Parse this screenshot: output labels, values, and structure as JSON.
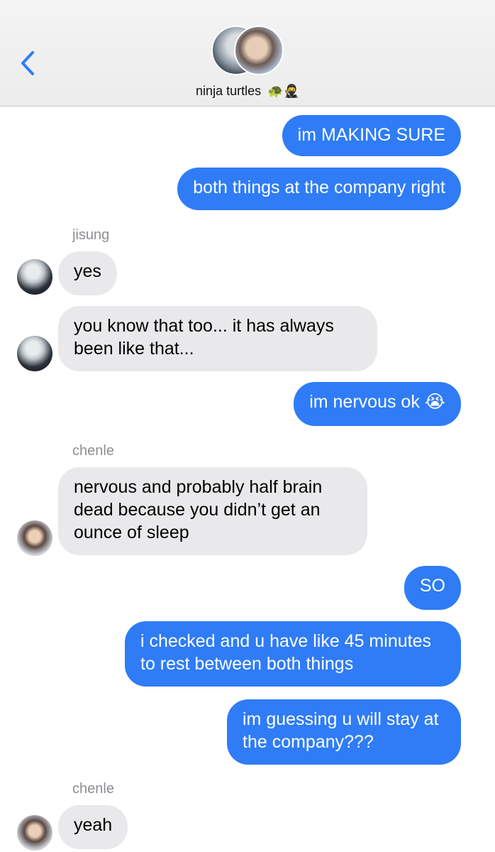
{
  "header": {
    "title": "ninja turtles",
    "title_emoji": "🐢🥷"
  },
  "messages": [
    {
      "type": "out",
      "text": "im MAKING SURE"
    },
    {
      "type": "out",
      "text": "both things at the company right"
    },
    {
      "sender": "jisung"
    },
    {
      "type": "in",
      "text": "yes"
    },
    {
      "type": "in",
      "lines": [
        "you know that too... it has always",
        "been like that..."
      ]
    },
    {
      "type": "out",
      "text": "im nervous ok",
      "emoji": "😭"
    },
    {
      "sender": "chenle"
    },
    {
      "type": "in",
      "lines": [
        "nervous and probably half brain",
        "dead because you didn’t get an",
        "ounce of sleep"
      ]
    },
    {
      "type": "out",
      "text": "SO"
    },
    {
      "type": "out",
      "lines": [
        "i checked and u have like 45 minutes",
        "to rest between both things"
      ]
    },
    {
      "type": "out",
      "lines": [
        "im guessing u will stay at",
        "the company???"
      ]
    },
    {
      "sender": "chenle"
    },
    {
      "type": "in",
      "text": "yeah"
    }
  ]
}
